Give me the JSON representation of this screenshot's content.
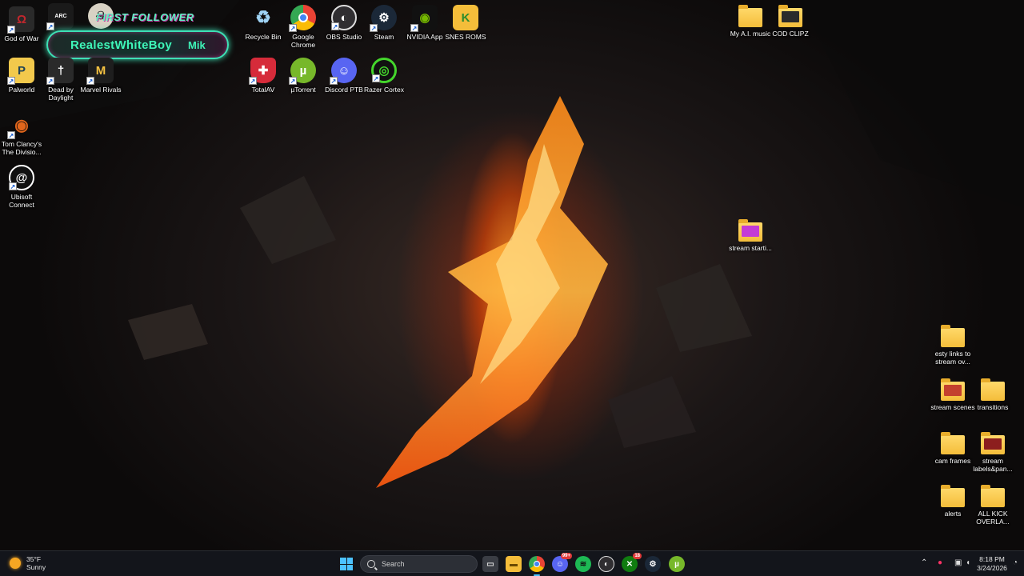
{
  "desktop": {
    "icons": [
      {
        "label": "God of War",
        "icon": "god-of-war-icon",
        "color": "#c1272d"
      },
      {
        "label": "ARC Raiders",
        "icon": "arc-raiders-icon",
        "color": "#1a1a1a"
      },
      {
        "label": "Palworld",
        "icon": "palworld-icon",
        "color": "#f2c94c"
      },
      {
        "label": "Dead by Daylight",
        "icon": "dead-by-daylight-icon",
        "color": "#2a2a2a"
      },
      {
        "label": "Marvel Rivals",
        "icon": "marvel-rivals-icon",
        "color": "#f5c242"
      },
      {
        "label": "Tom Clancy's The Divisio...",
        "icon": "the-division-icon",
        "color": "#e2661b"
      },
      {
        "label": "Ubisoft Connect",
        "icon": "ubisoft-connect-icon",
        "color": "#ffffff"
      },
      {
        "label": "Recycle Bin",
        "icon": "recycle-bin-icon",
        "color": "#9fd3f5"
      },
      {
        "label": "Google Chrome",
        "icon": "chrome-icon",
        "color": "#4285f4"
      },
      {
        "label": "OBS Studio",
        "icon": "obs-icon",
        "color": "#302e31"
      },
      {
        "label": "Steam",
        "icon": "steam-icon",
        "color": "#1b2838"
      },
      {
        "label": "NVIDIA App",
        "icon": "nvidia-icon",
        "color": "#76b900"
      },
      {
        "label": "SNES ROMS",
        "icon": "snes-folder-icon",
        "color": "#f4bd3a"
      },
      {
        "label": "TotalAV",
        "icon": "totalav-icon",
        "color": "#d62b3a"
      },
      {
        "label": "µTorrent",
        "icon": "utorrent-icon",
        "color": "#77b82a"
      },
      {
        "label": "Discord PTB",
        "icon": "discord-icon",
        "color": "#5865f2"
      },
      {
        "label": "Razer Cortex",
        "icon": "razer-cortex-icon",
        "color": "#44d62c"
      },
      {
        "label": "My A.I. music",
        "icon": "folder-icon",
        "color": "#f4bd3a"
      },
      {
        "label": "COD CLIPZ",
        "icon": "folder-icon",
        "color": "#f4bd3a"
      },
      {
        "label": "stream starti...",
        "icon": "folder-icon",
        "color": "#c43bd6"
      },
      {
        "label": "esty links to stream ov...",
        "icon": "folder-icon",
        "color": "#f4bd3a"
      },
      {
        "label": "stream scenes",
        "icon": "folder-icon",
        "color": "#f4bd3a"
      },
      {
        "label": "transitions",
        "icon": "folder-icon",
        "color": "#f4bd3a"
      },
      {
        "label": "cam frames",
        "icon": "folder-icon",
        "color": "#f4bd3a"
      },
      {
        "label": "stream labels&pan...",
        "icon": "folder-icon",
        "color": "#f4bd3a"
      },
      {
        "label": "alerts",
        "icon": "folder-icon",
        "color": "#f4bd3a"
      },
      {
        "label": "ALL KICK OVERLA...",
        "icon": "folder-icon",
        "color": "#f4bd3a"
      }
    ]
  },
  "overlay": {
    "title": "FIRST FOLLOWER",
    "name": "RealestWhiteBoy",
    "extra": "Mik"
  },
  "taskbar": {
    "weather_temp": "35°F",
    "weather_desc": "Sunny",
    "search_label": "Search",
    "apps": [
      {
        "icon": "task-view-icon",
        "badge": ""
      },
      {
        "icon": "file-explorer-icon",
        "badge": ""
      },
      {
        "icon": "chrome-icon",
        "badge": ""
      },
      {
        "icon": "discord-icon",
        "badge": "99+"
      },
      {
        "icon": "spotify-icon",
        "badge": ""
      },
      {
        "icon": "obs-icon",
        "badge": ""
      },
      {
        "icon": "xbox-icon",
        "badge": "18"
      },
      {
        "icon": "steam-icon",
        "badge": ""
      },
      {
        "icon": "utorrent-icon",
        "badge": ""
      }
    ],
    "time": "8:18 PM",
    "date": "3/24/2026"
  }
}
